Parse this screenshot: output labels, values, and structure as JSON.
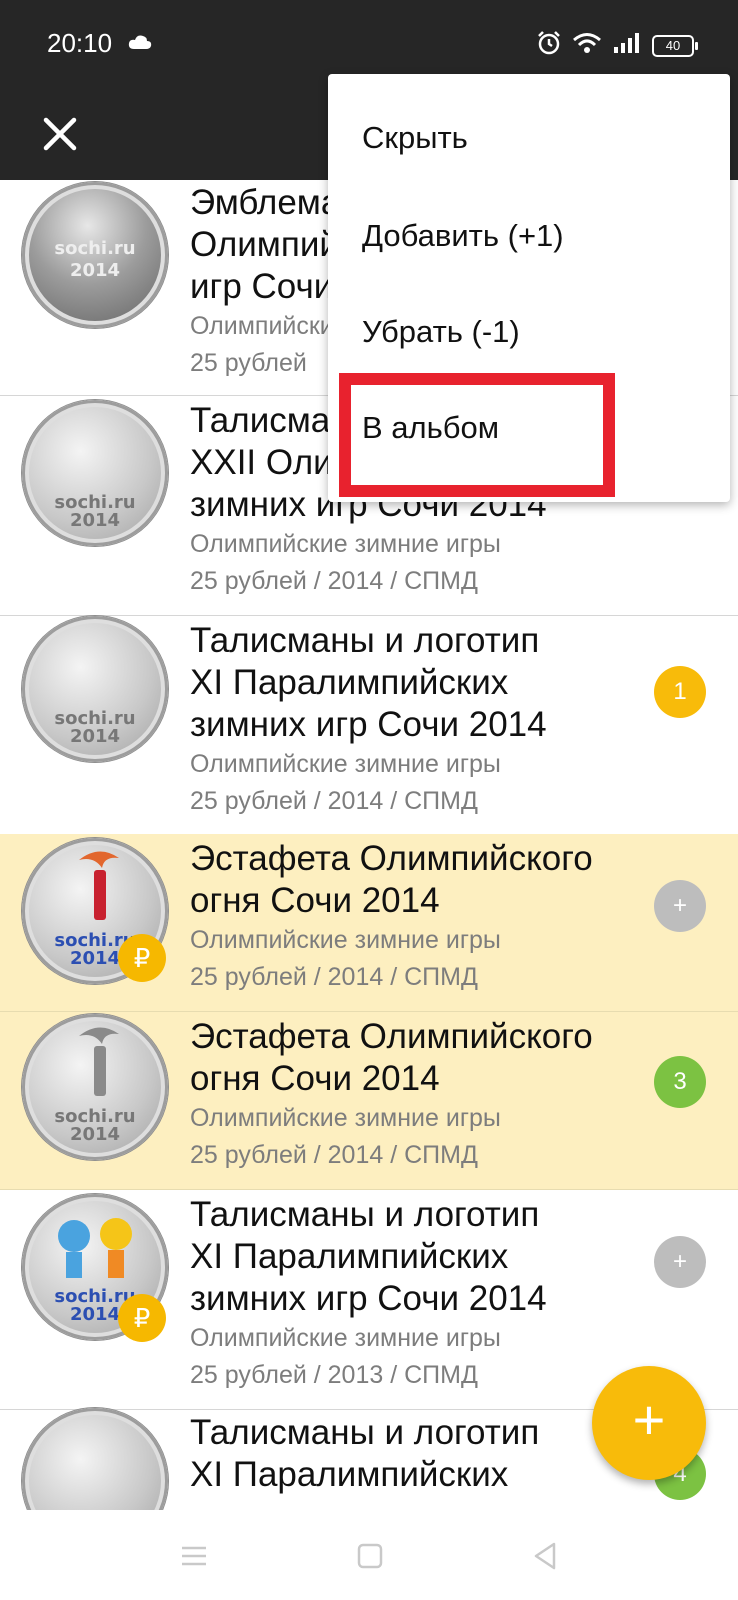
{
  "status_bar": {
    "time": "20:10",
    "battery": "40",
    "icons": [
      "cloud-icon",
      "alarm-icon",
      "wifi-icon",
      "signal-icon",
      "battery-icon"
    ]
  },
  "app_bar": {
    "close_icon": "close-icon"
  },
  "menu": {
    "items": [
      {
        "label": "Скрыть"
      },
      {
        "label": "Добавить (+1)"
      },
      {
        "label": "Убрать (-1)"
      },
      {
        "label": "В альбом"
      }
    ]
  },
  "items": [
    {
      "title_lines": [
        "Эмблема XXII",
        "Олимпийских",
        "игр Сочи 2014"
      ],
      "category": "Олимпийские",
      "details": "25 рублей",
      "badge": ""
    },
    {
      "title_lines": [
        "Талисманы",
        "XXII Олимпийских",
        "зимних игр Сочи 2014"
      ],
      "category": "Олимпийские зимние игры",
      "details": "25 рублей / 2014 / СПМД",
      "badge": ""
    },
    {
      "title_lines": [
        "Талисманы и логотип",
        "XI Паралимпийских",
        "зимних игр Сочи 2014"
      ],
      "category": "Олимпийские зимние игры",
      "details": "25 рублей / 2014 / СПМД",
      "badge": "1"
    },
    {
      "title_lines": [
        "Эстафета Олимпийского",
        "огня Сочи 2014"
      ],
      "category": "Олимпийские зимние игры",
      "details": "25 рублей / 2014 / СПМД",
      "badge": "+",
      "ruble": "₽"
    },
    {
      "title_lines": [
        "Эстафета Олимпийского",
        "огня Сочи 2014"
      ],
      "category": "Олимпийские зимние игры",
      "details": "25 рублей / 2014 / СПМД",
      "badge": "3"
    },
    {
      "title_lines": [
        "Талисманы и логотип",
        "XI Паралимпийских",
        "зимних игр Сочи 2014"
      ],
      "category": "Олимпийские зимние игры",
      "details": "25 рублей / 2013 / СПМД",
      "badge": "+",
      "ruble": "₽"
    },
    {
      "title_lines": [
        "Талисманы и логотип",
        "XI Паралимпийских"
      ],
      "category": "",
      "details": "",
      "badge": "4"
    }
  ],
  "coin_labels": {
    "sochi": "sochi.ru",
    "year": "2014"
  },
  "fab": {
    "label": "+"
  },
  "nav": {
    "icons": [
      "menu-icon",
      "home-icon",
      "back-icon"
    ]
  },
  "colors": {
    "accent": "#f8bb0a",
    "highlight_row": "#fdefc0",
    "badge_green": "#7cc242",
    "badge_grey": "#bdbdbd",
    "annotation_red": "#e8222e",
    "top_bar": "#262626"
  }
}
